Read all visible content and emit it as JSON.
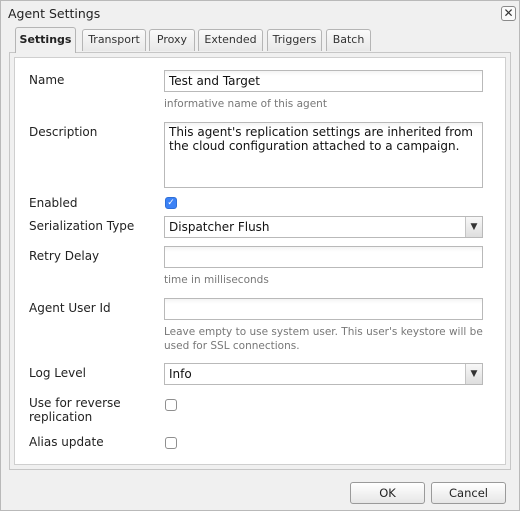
{
  "dialog": {
    "title": "Agent Settings",
    "close_icon": "close-icon"
  },
  "tabs": [
    {
      "label": "Settings",
      "active": true
    },
    {
      "label": "Transport",
      "active": false
    },
    {
      "label": "Proxy",
      "active": false
    },
    {
      "label": "Extended",
      "active": false
    },
    {
      "label": "Triggers",
      "active": false
    },
    {
      "label": "Batch",
      "active": false
    }
  ],
  "form": {
    "name": {
      "label": "Name",
      "value": "Test and Target",
      "hint": "informative name of this agent"
    },
    "description": {
      "label": "Description",
      "value": "This agent's replication settings are inherited from the cloud configuration attached to a campaign."
    },
    "enabled": {
      "label": "Enabled",
      "checked": true
    },
    "serialization_type": {
      "label": "Serialization Type",
      "value": "Dispatcher Flush"
    },
    "retry_delay": {
      "label": "Retry Delay",
      "value": "",
      "hint": "time in milliseconds"
    },
    "agent_user_id": {
      "label": "Agent User Id",
      "value": "",
      "hint": "Leave empty to use system user. This user's keystore will be used for SSL connections."
    },
    "log_level": {
      "label": "Log Level",
      "value": "Info"
    },
    "reverse_replication": {
      "label": "Use for reverse replication",
      "checked": false
    },
    "alias_update": {
      "label": "Alias update",
      "checked": false
    }
  },
  "buttons": {
    "ok": "OK",
    "cancel": "Cancel"
  }
}
